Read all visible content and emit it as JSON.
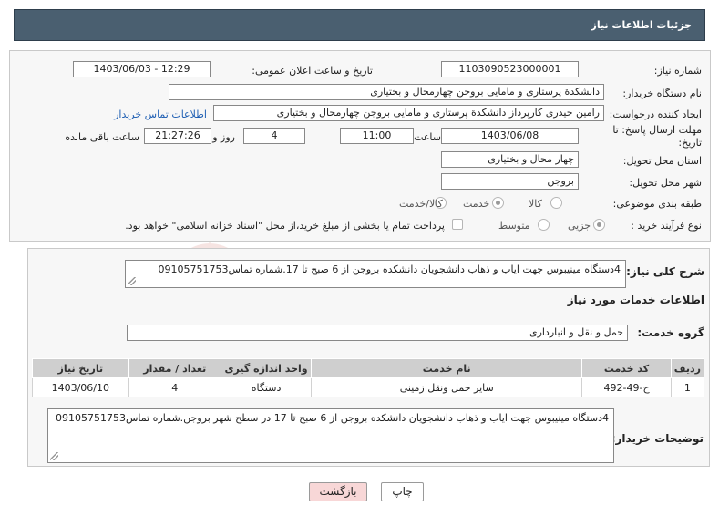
{
  "page_title": "جزئیات اطلاعات نیاز",
  "fields": {
    "need_number_label": "شماره نیاز:",
    "need_number": "1103090523000001",
    "announce_label": "تاریخ و ساعت اعلان عمومی:",
    "announce_value": "1403/06/03 - 12:29",
    "buyer_label": "نام دستگاه خریدار:",
    "buyer": "دانشکدة پرستاری و مامایی بروجن چهارمحال و بختیاری",
    "creator_label": "ایجاد کننده درخواست:",
    "creator": "رامین حیدری کارپرداز دانشکدة پرستاری و مامایی بروجن چهارمحال و بختیاری",
    "contact_link": "اطلاعات تماس خریدار",
    "deadline_label": "مهلت ارسال پاسخ: تا تاریخ:",
    "deadline_date": "1403/06/08",
    "time_label": "ساعت",
    "deadline_time": "11:00",
    "day_and_label": "روز و",
    "days": "4",
    "remaining_time": "21:27:26",
    "remaining_label": "ساعت باقی مانده",
    "province_label": "استان محل تحویل:",
    "province": "چهار محال و بختیاری",
    "city_label": "شهر محل تحویل:",
    "city": "بروجن",
    "category_label": "طبقه بندی موضوعی:",
    "category_options": [
      "کالا",
      "خدمت",
      "کالا/خدمت"
    ],
    "category_selected": "خدمت",
    "process_label": "نوع فرآیند خرید :",
    "process_options": [
      "جزیی",
      "متوسط"
    ],
    "process_selected": "جزیی",
    "payment_note": "پرداخت تمام یا بخشی از مبلغ خرید،از محل \"اسناد خزانه اسلامی\" خواهد بود."
  },
  "summary": {
    "label": "شرح کلی نیاز:",
    "text": "4دستگاه مینیبوس جهت ایاب و ذهاب دانشجویان دانشکده بروجن از 6 صبح تا 17.شماره تماس09105751753"
  },
  "services_title": "اطلاعات خدمات مورد نیاز",
  "service_group": {
    "label": "گروه خدمت:",
    "value": "حمل و نقل و انبارداری"
  },
  "table": {
    "headers": [
      "ردیف",
      "کد خدمت",
      "نام خدمت",
      "واحد اندازه گیری",
      "تعداد / مقدار",
      "تاریخ نیاز"
    ],
    "rows": [
      [
        "1",
        "ح-49-492",
        "سایر حمل ونقل زمینی",
        "دستگاه",
        "4",
        "1403/06/10"
      ]
    ]
  },
  "buyer_notes": {
    "label": "توضیحات خریدار:",
    "text": "4دستگاه مینیبوس جهت ایاب و ذهاب دانشجویان دانشکده بروجن از 6 صبح تا 17 در سطح شهر بروجن.شماره تماس09105751753"
  },
  "buttons": {
    "print": "چاپ",
    "back": "بازگشت"
  },
  "watermark_text": "AriaTender.neT",
  "colors": {
    "header_bg": "#4a5f70",
    "link": "#1f5fb3",
    "back_button_bg": "#f8d7d7",
    "table_header_bg": "#cfcfcf",
    "watermark": "#c0392b"
  }
}
